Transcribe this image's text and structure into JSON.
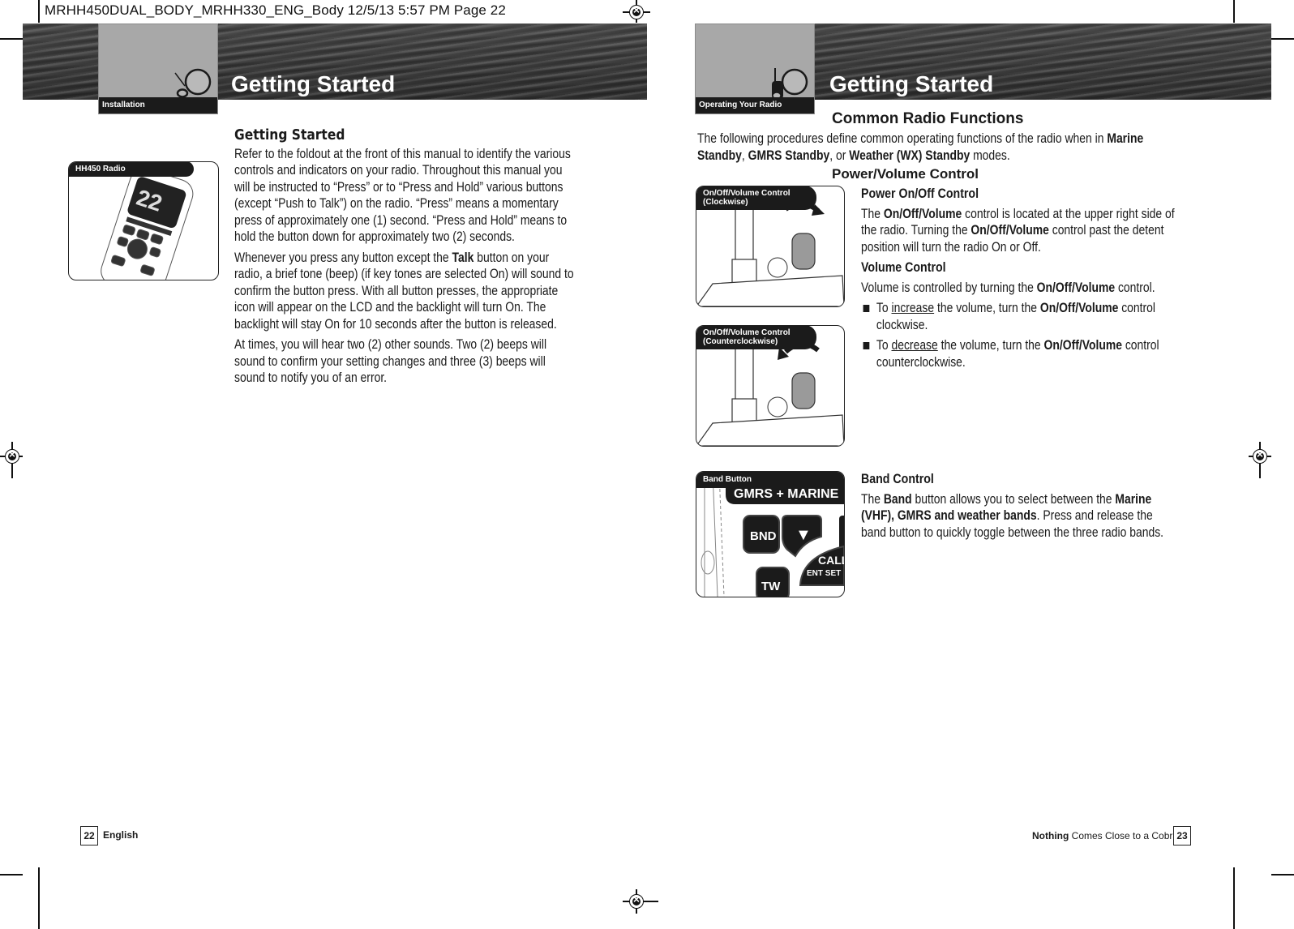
{
  "slug": "MRHH450DUAL_BODY_MRHH330_ENG_Body  12/5/13  5:57 PM  Page 22",
  "left_page": {
    "section_tab": "Installation",
    "banner_title": "Getting Started",
    "figure_label": "HH450 Radio",
    "heading": "Getting Started",
    "paragraphs": [
      "Refer to the foldout at the front of this manual to identify the various controls and indicators on your radio. Throughout this manual you will be instructed to “Press” or to “Press and Hold” various buttons (except “Push to Talk”) on the radio. “Press” means a momentary press of approximately one (1) second. “Press and Hold” means to hold the button down for approximately two (2) seconds."
    ],
    "para2_pre": "Whenever you press any button except the ",
    "para2_bold": "Talk",
    "para2_post": " button on your radio, a brief tone (beep) (if key tones are selected On) will sound to confirm the button press. With all button presses, the appropriate icon will appear on the LCD and the backlight will turn On. The backlight will stay On for 10 seconds after the button is released.",
    "para3": "At times, you will hear two (2) other sounds. Two (2) beeps will sound to confirm your setting changes and three (3) beeps will sound to notify you of an error.",
    "footer_page": "22",
    "footer_text": "English"
  },
  "right_page": {
    "section_tab": "Operating Your Radio",
    "banner_title": "Getting Started",
    "heading": "Common Radio Functions",
    "intro_pre": "The following procedures define common operating functions of the radio when in ",
    "intro_b1": "Marine Standby",
    "intro_sep1": ", ",
    "intro_b2": "GMRS Standby",
    "intro_sep2": ", or ",
    "intro_b3": "Weather (WX) Standby",
    "intro_post": " modes.",
    "power_volume_heading": "Power/Volume Control",
    "power_subhead": "Power On/Off Control",
    "power_p_1": "The ",
    "power_p_b1": "On/Off/Volume",
    "power_p_2": " control is located at the upper right side of the radio. Turning the ",
    "power_p_b2": "On/Off/Volume",
    "power_p_3": " control past the detent position will turn the radio On or Off.",
    "volume_subhead": "Volume Control",
    "volume_p_1": "Volume is controlled by turning the ",
    "volume_p_b": "On/Off/Volume",
    "volume_p_2": " control.",
    "bullets": [
      {
        "pre": "To ",
        "u": "increase",
        "mid": " the volume, turn the ",
        "b": "On/Off/Volume",
        "post": " control clockwise."
      },
      {
        "pre": "To ",
        "u": "decrease",
        "mid": " the volume, turn the ",
        "b": "On/Off/Volume",
        "post": " control counterclockwise."
      }
    ],
    "band_subhead": "Band Control",
    "band_p_1": "The ",
    "band_p_b1": "Band",
    "band_p_2": " button allows you to select between the ",
    "band_p_b2": "Marine (VHF), GMRS and weather bands",
    "band_p_3": ". Press and release the band button to quickly toggle between the three radio bands.",
    "figures": {
      "cw_label_1": "On/Off/Volume Control",
      "cw_label_2": "(Clockwise)",
      "ccw_label_1": "On/Off/Volume Control",
      "ccw_label_2": "(Counterclockwise)",
      "band_label": "Band Button",
      "band_panel_text": "GMRS + MARINE",
      "band_buttons": [
        "BND",
        "▼",
        "CALL",
        "ENT SET",
        "TW"
      ]
    },
    "footer_bold": "Nothing",
    "footer_text": " Comes Close to a Cobra",
    "footer_reg": "®",
    "footer_page": "23"
  }
}
